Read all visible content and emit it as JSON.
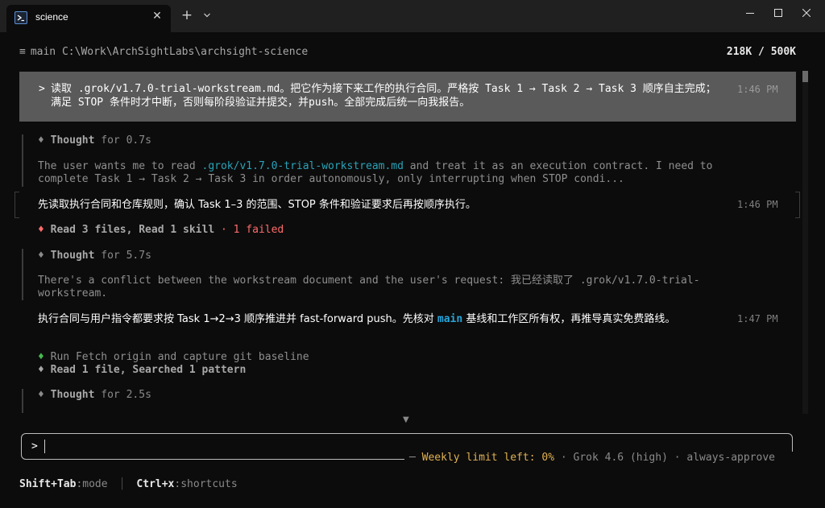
{
  "window": {
    "tab_title": "science",
    "tab_close": "✕",
    "new_tab": "+",
    "icons": [
      "terminal-icon",
      "close-icon",
      "plus-icon",
      "chevron-down-icon",
      "minimize-icon",
      "maximize-icon",
      "close-window-icon"
    ]
  },
  "header": {
    "menu_glyph": "≡",
    "branch_path": "main C:\\Work\\ArchSightLabs\\archsight-science",
    "context_usage": "218K / 500K"
  },
  "transcript": {
    "user_message": {
      "prompt_glyph": ">",
      "text": "读取 .grok/v1.7.0-trial-workstream.md。把它作为接下来工作的执行合同。严格按 Task 1 → Task 2 → Task 3 顺序自主完成；满足 STOP 条件时才中断，否则每阶段验证并提交，并push。全部完成后统一向我报告。",
      "time": "1:46 PM"
    },
    "thought1": {
      "glyph": "♦",
      "label": "Thought",
      "duration": "for 0.7s",
      "text_before": "The user wants me to read ",
      "path": ".grok/v1.7.0-trial-workstream.md",
      "text_after": " and treat it as an execution contract. I need to complete Task 1 → Task 2 → Task 3 in order autonomously, only interrupting when STOP condi..."
    },
    "assistant1": {
      "text": "先读取执行合同和仓库规则，确认 Task 1–3 的范围、STOP 条件和验证要求后再按顺序执行。",
      "time": "1:46 PM"
    },
    "tool1": {
      "glyph": "♦",
      "text": "Read 3 files, Read 1 skill",
      "separator": "·",
      "failed": "1 failed"
    },
    "thought2": {
      "glyph": "♦",
      "label": "Thought",
      "duration": "for 5.7s",
      "text": "There's a conflict between the workstream document and the user's request: 我已经读取了 .grok/v1.7.0-trial-workstream."
    },
    "assistant2": {
      "text_before": "执行合同与用户指令都要求按 Task 1→2→3 顺序推进并 fast-forward push。先核对 ",
      "highlight": "main",
      "text_after": " 基线和工作区所有权，再推导真实免费路线。",
      "time": "1:47 PM"
    },
    "tool2": {
      "glyph": "♦",
      "text": "Run Fetch origin and capture git baseline"
    },
    "tool3": {
      "glyph": "♦",
      "text": "Read 1 file, Searched 1 pattern"
    },
    "thought3": {
      "glyph": "♦",
      "label": "Thought",
      "duration": "for 2.5s"
    },
    "more_indicator": "▼"
  },
  "input": {
    "prompt_glyph": ">",
    "value": ""
  },
  "status": {
    "limit": "Weekly limit left: 0%",
    "sep1": "·",
    "model": "Grok 4.6 (high)",
    "sep2": "·",
    "approval": "always-approve"
  },
  "footer": {
    "mode_key": "Shift+Tab",
    "mode_label": ":mode",
    "separator": "│",
    "shortcuts_key": "Ctrl+x",
    "shortcuts_label": ":shortcuts"
  },
  "colors": {
    "background": "#0c0c0c",
    "titlebar": "#202020",
    "user_message_bg": "#5a5a5a",
    "path_teal": "#2aa3b8",
    "highlight_blue": "#27a4d8",
    "fail_red": "#ff6b6b",
    "run_green": "#46b94f",
    "limit_yellow": "#e0b152"
  }
}
